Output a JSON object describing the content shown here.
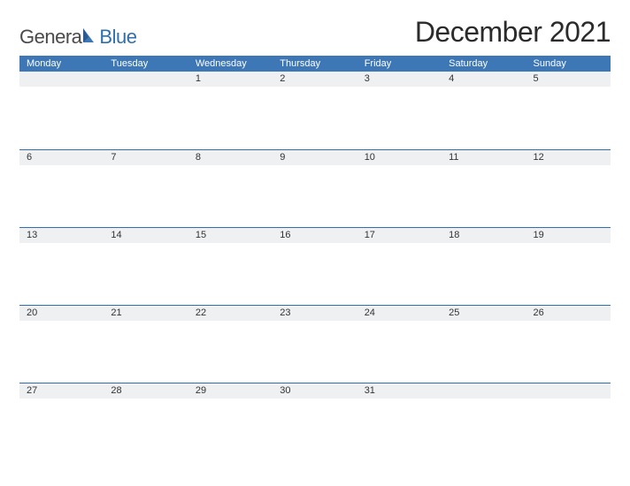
{
  "brand": {
    "name_part1": "Genera",
    "name_part2": "Blue"
  },
  "title": "December 2021",
  "days_of_week": [
    "Monday",
    "Tuesday",
    "Wednesday",
    "Thursday",
    "Friday",
    "Saturday",
    "Sunday"
  ],
  "weeks": [
    [
      "",
      "",
      "1",
      "2",
      "3",
      "4",
      "5"
    ],
    [
      "6",
      "7",
      "8",
      "9",
      "10",
      "11",
      "12"
    ],
    [
      "13",
      "14",
      "15",
      "16",
      "17",
      "18",
      "19"
    ],
    [
      "20",
      "21",
      "22",
      "23",
      "24",
      "25",
      "26"
    ],
    [
      "27",
      "28",
      "29",
      "30",
      "31",
      "",
      ""
    ]
  ],
  "colors": {
    "header_bg": "#3e77b5",
    "row_rule": "#2f6fab",
    "daynum_bg": "#eef0f2"
  }
}
